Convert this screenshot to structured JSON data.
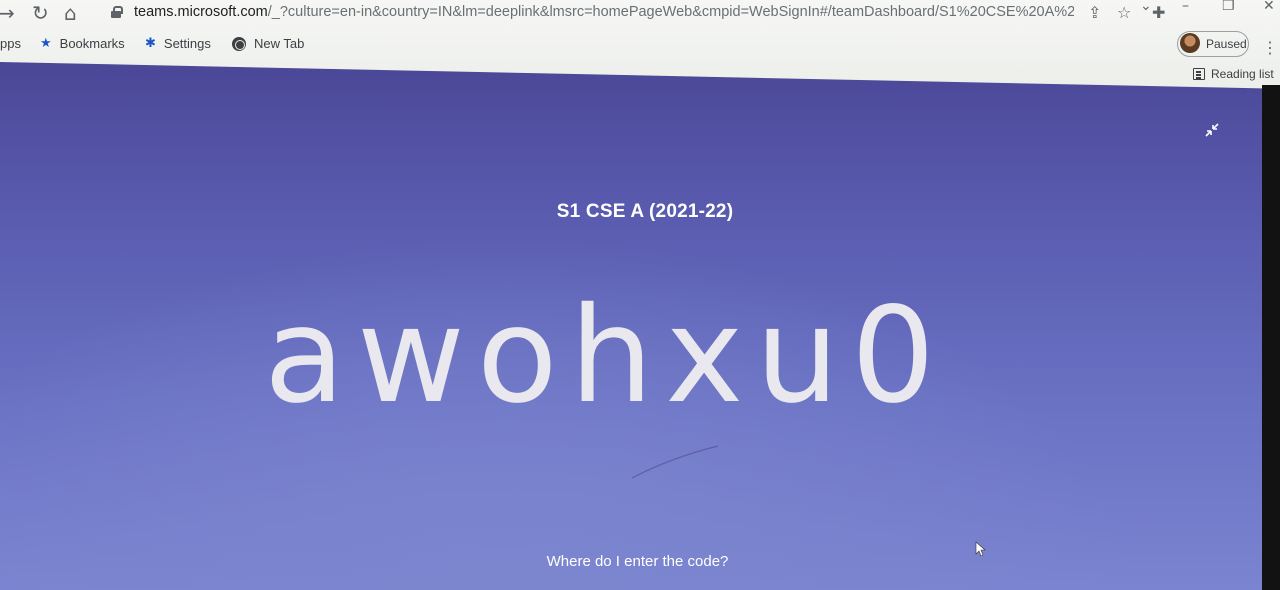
{
  "browser": {
    "url_host": "teams.microsoft.com",
    "url_path": "/_?culture=en-in&country=IN&lm=deeplink&lmsrc=homePageWeb&cmpid=WebSignIn#/teamDashboard/S1%20CSE%20A%20(202...",
    "profile_status": "Paused",
    "reading_list_label": "Reading list",
    "bookmarks": [
      {
        "label": "pps"
      },
      {
        "label": "Bookmarks",
        "icon": "star-icon"
      },
      {
        "label": "Settings",
        "icon": "gear-icon"
      },
      {
        "label": "New Tab",
        "icon": "globe-icon"
      }
    ]
  },
  "team": {
    "title": "S1 CSE A (2021-22)",
    "join_code": "awohxu0",
    "help_link": "Where do I enter the code?"
  },
  "colors": {
    "background_top": "#4b4797",
    "background_bottom": "#7a84d0",
    "code_text": "#e8e8ee"
  }
}
